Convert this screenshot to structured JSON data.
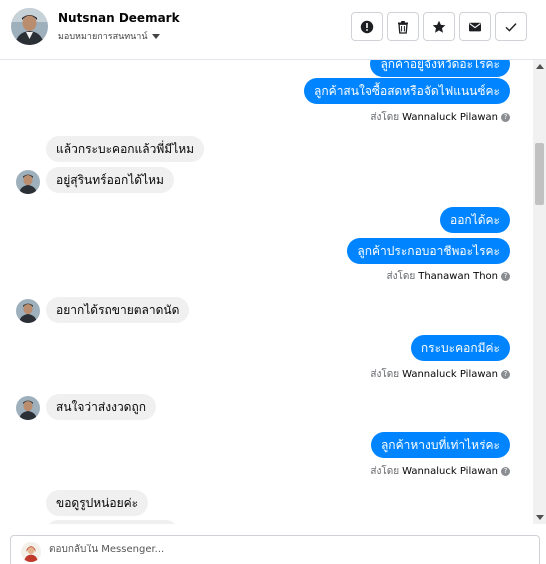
{
  "header": {
    "name": "Nutsnan Deemark",
    "assigned_label": "มอบหมายการสนทนาน์"
  },
  "colors": {
    "accent": "#0084ff",
    "incoming_bg": "#f0f0f0",
    "muted": "#65676b"
  },
  "actions": [
    {
      "icon": "alert-icon",
      "name": "mark-spam-button"
    },
    {
      "icon": "trash-icon",
      "name": "delete-button"
    },
    {
      "icon": "star-icon",
      "name": "star-button"
    },
    {
      "icon": "envelope-icon",
      "name": "mark-unread-button"
    },
    {
      "icon": "checkmark-icon",
      "name": "mark-done-button"
    }
  ],
  "messages": [
    {
      "dir": "out",
      "text": "ลูกค้าอยู่จังหวัดอะไรคะ"
    },
    {
      "dir": "out",
      "text": "ลูกค้าสนใจซื้อสดหรือจัดไฟแนนซ์คะ"
    },
    {
      "sent_prefix": "ส่งโดย",
      "sender": "Wannaluck Pilawan"
    },
    {
      "dir": "in",
      "text": "แล้วกระบะคอกแล้วพี่มีไหม"
    },
    {
      "dir": "in",
      "text": "อยู่สุรินทร์ออกได้ไหม"
    },
    {
      "dir": "out",
      "text": "ออกได้คะ"
    },
    {
      "dir": "out",
      "text": "ลูกค้าประกอบอาชีพอะไรคะ"
    },
    {
      "sent_prefix": "ส่งโดย",
      "sender": "Thanawan Thon"
    },
    {
      "dir": "in",
      "text": "อยากได้รถขายตลาดนัด"
    },
    {
      "dir": "out",
      "text": "กระบะคอกมีค่ะ"
    },
    {
      "sent_prefix": "ส่งโดย",
      "sender": "Wannaluck Pilawan"
    },
    {
      "dir": "in",
      "text": "สนใจว่าส่งงวดถูก"
    },
    {
      "dir": "out",
      "text": "ลูกค้าหางบที่เท่าไหร่คะ"
    },
    {
      "sent_prefix": "ส่งโดย",
      "sender": "Wannaluck Pilawan"
    },
    {
      "dir": "in",
      "text": "ขอดูรูปหน่อยค่ะ"
    }
  ],
  "reply": {
    "placeholder": "ตอบกลับใน Messenger..."
  }
}
